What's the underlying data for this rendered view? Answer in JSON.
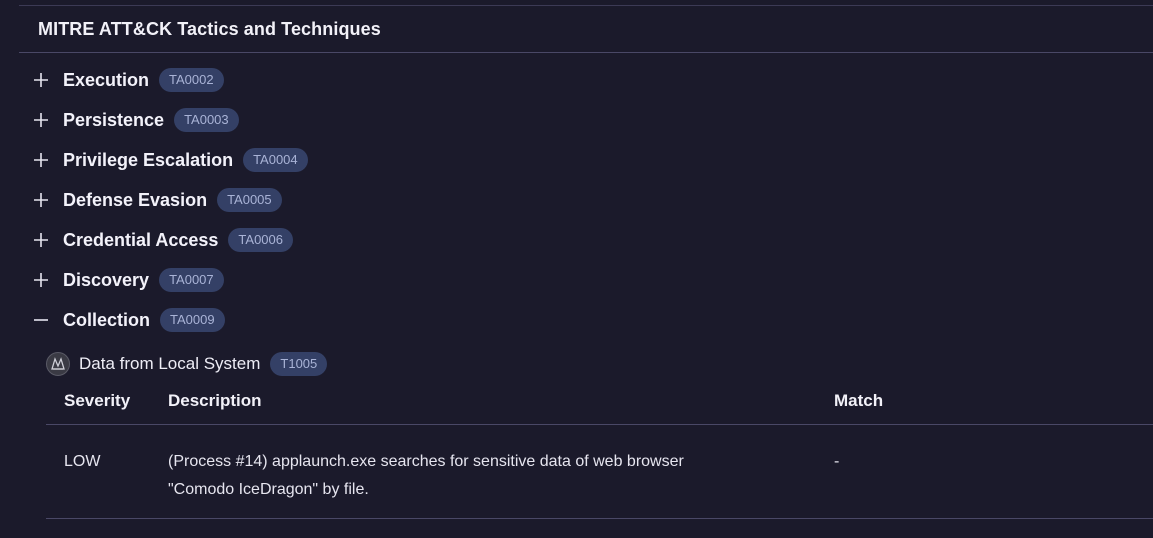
{
  "header": {
    "title": "MITRE ATT&CK Tactics and Techniques"
  },
  "tactics": [
    {
      "name": "Execution",
      "id": "TA0002",
      "expanded": false
    },
    {
      "name": "Persistence",
      "id": "TA0003",
      "expanded": false
    },
    {
      "name": "Privilege Escalation",
      "id": "TA0004",
      "expanded": false
    },
    {
      "name": "Defense Evasion",
      "id": "TA0005",
      "expanded": false
    },
    {
      "name": "Credential Access",
      "id": "TA0006",
      "expanded": false
    },
    {
      "name": "Discovery",
      "id": "TA0007",
      "expanded": false
    },
    {
      "name": "Collection",
      "id": "TA0009",
      "expanded": true
    }
  ],
  "technique": {
    "name": "Data from Local System",
    "id": "T1005",
    "icon": "mitre-logo-icon"
  },
  "table": {
    "headers": {
      "severity": "Severity",
      "description": "Description",
      "match": "Match"
    },
    "rows": [
      {
        "severity": "LOW",
        "description_line1": "(Process #14) applaunch.exe searches for sensitive data of web browser",
        "description_line2": "\"Comodo IceDragon\" by file.",
        "match": "-"
      }
    ]
  },
  "colors": {
    "background": "#1b1a2b",
    "badge_bg": "#344066",
    "badge_text": "#a9b3d6",
    "divider": "#4a4866"
  }
}
